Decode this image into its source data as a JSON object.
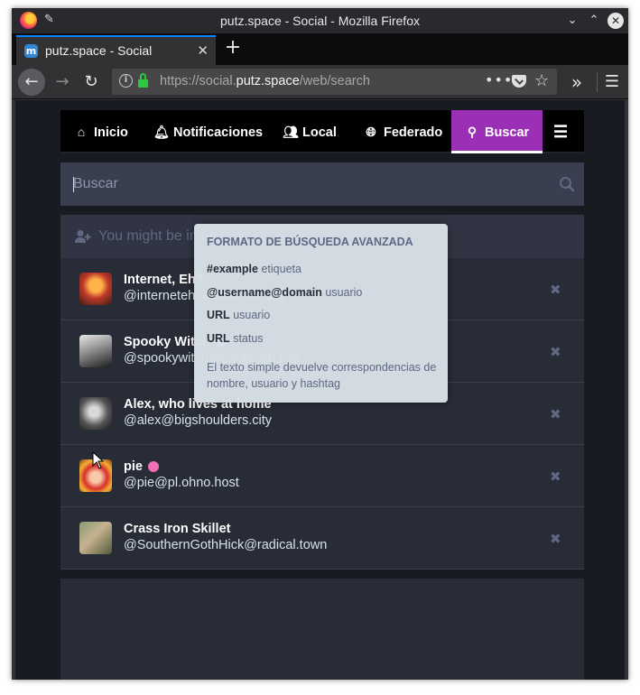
{
  "window": {
    "title": "putz.space - Social - Mozilla Firefox"
  },
  "tab": {
    "label": "putz.space - Social",
    "favicon_letter": "m"
  },
  "urlbar": {
    "url_prefix": "https://social.",
    "url_host": "putz.space",
    "url_path": "/web/search",
    "meatball": "•••"
  },
  "mastodon_nav": {
    "items": [
      {
        "label": "Inicio",
        "icon": "home-icon"
      },
      {
        "label": "Notificaciones",
        "icon": "bell-icon"
      },
      {
        "label": "Local",
        "icon": "users-icon"
      },
      {
        "label": "Federado",
        "icon": "globe-icon"
      },
      {
        "label": "Buscar",
        "icon": "search-icon",
        "active": true
      }
    ],
    "menu_icon": "hamburger-icon",
    "accent_color": "#9b2fb5"
  },
  "search": {
    "placeholder": "Buscar",
    "value": ""
  },
  "suggestions": {
    "header": "You might be interested in",
    "accounts": [
      {
        "name": "Internet, Eh?",
        "handle": "@interneteh@sunbeam.city"
      },
      {
        "name": "Spooky Witch",
        "handle": "@spookywitch@sunbeam.city",
        "badge": "verified-emoji"
      },
      {
        "name": "Alex, who lives at home",
        "handle": "@alex@bigshoulders.city"
      },
      {
        "name": "pie",
        "handle": "@pie@pl.ohno.host",
        "badge": "pink-emoji"
      },
      {
        "name": "Crass Iron Skillet",
        "handle": "@SouthernGothHick@radical.town"
      }
    ]
  },
  "search_help": {
    "title": "FORMATO DE BÚSQUEDA AVANZADA",
    "rows": [
      {
        "term": "#example",
        "desc": "etiqueta"
      },
      {
        "term": "@username@domain",
        "desc": "usuario"
      },
      {
        "term": "URL",
        "desc": "usuario"
      },
      {
        "term": "URL",
        "desc": "status"
      }
    ],
    "hint": "El texto simple devuelve correspondencias de nombre, usuario y hashtag"
  }
}
